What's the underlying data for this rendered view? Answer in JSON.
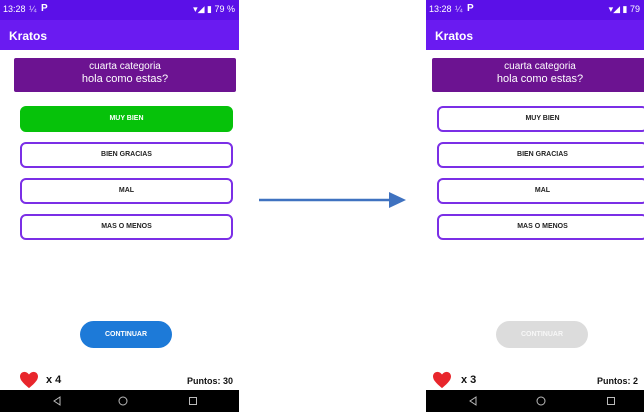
{
  "left": {
    "status": {
      "time": "13:28",
      "icons": "▾◢ ▮ 79 %"
    },
    "app_title": "Kratos",
    "category": "cuarta categoria",
    "question": "hola como estas?",
    "answers": [
      "MUY BIEN",
      "BIEN GRACIAS",
      "MAL",
      "MAS O MENOS"
    ],
    "selected_correct": "MUY BIEN",
    "continue_label": "CONTINUAR",
    "continue_enabled": true,
    "lives": "x 4",
    "points": "Puntos: 30"
  },
  "right": {
    "status": {
      "time": "13:28",
      "icons": "▾◢ ▮ 79"
    },
    "app_title": "Kratos",
    "category": "cuarta categoria",
    "question": "hola como estas?",
    "answers": [
      "MUY BIEN",
      "BIEN GRACIAS",
      "MAL",
      "MAS O MENOS"
    ],
    "continue_label": "CONTINUAR",
    "continue_enabled": false,
    "lives": "x 3",
    "points": "Puntos: 2"
  },
  "colors": {
    "statusbar": "#5b10e8",
    "appbar": "#6a1bf1",
    "question_card": "#6c1391",
    "answer_border": "#7b2fe6",
    "correct": "#06c20a",
    "continue_active": "#1d7ad8",
    "continue_disabled": "#dcdcdc",
    "heart": "#e8262c",
    "arrow": "#3f72c0"
  }
}
